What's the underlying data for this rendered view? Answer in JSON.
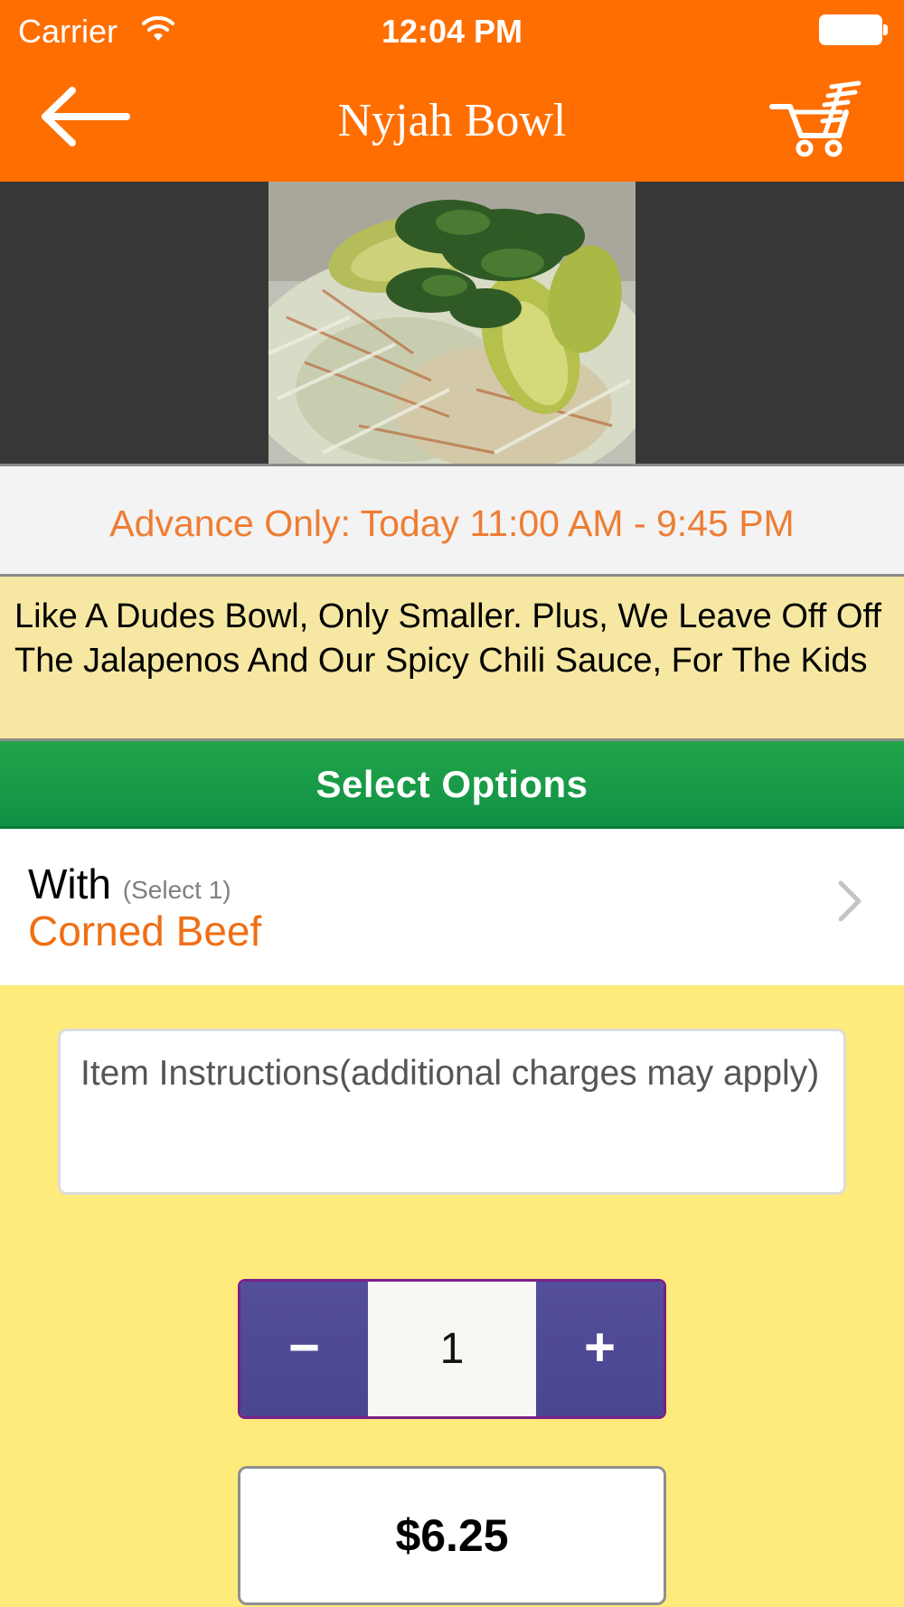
{
  "status_bar": {
    "carrier": "Carrier",
    "time": "12:04 PM"
  },
  "nav": {
    "title": "Nyjah Bowl",
    "back_icon": "arrow-left-icon",
    "cart_icon": "shopping-cart-icon"
  },
  "availability": "Advance Only: Today 11:00 AM - 9:45 PM",
  "description": "Like A Dudes Bowl, Only Smaller. Plus, We Leave Off Off The Jalapenos And Our Spicy Chili Sauce, For The Kids",
  "options": {
    "header": "Select Options",
    "group_label": "With",
    "group_hint": "(Select 1)",
    "selected": "Corned Beef"
  },
  "instructions": {
    "placeholder": "Item Instructions(additional charges may apply)"
  },
  "quantity": {
    "minus": "−",
    "value": "1",
    "plus": "+"
  },
  "price": "$6.25",
  "colors": {
    "nav_bg": "#ff6e00",
    "accent_text": "#ef6f14",
    "options_bar": "#139746",
    "stepper": "#4f4a95",
    "page_bg": "#ffeb7c"
  }
}
